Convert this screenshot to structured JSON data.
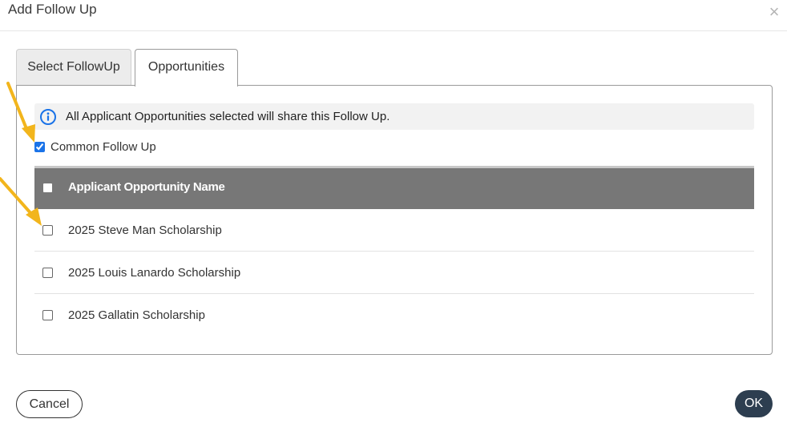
{
  "dialog": {
    "title": "Add Follow Up",
    "close_icon": "close-icon"
  },
  "tabs": [
    {
      "label": "Select FollowUp",
      "active": false
    },
    {
      "label": "Opportunities",
      "active": true
    }
  ],
  "info": {
    "icon": "info-icon",
    "text": "All Applicant Opportunities selected will share this Follow Up."
  },
  "common_follow_up": {
    "label": "Common Follow Up",
    "checked": true
  },
  "table": {
    "header": "Applicant Opportunity Name",
    "rows": [
      {
        "name": "2025 Steve Man Scholarship",
        "checked": false
      },
      {
        "name": "2025 Louis Lanardo Scholarship",
        "checked": false
      },
      {
        "name": "2025 Gallatin Scholarship",
        "checked": false
      }
    ]
  },
  "footer": {
    "cancel_label": "Cancel",
    "ok_label": "OK"
  },
  "colors": {
    "header_bg": "#777777",
    "ok_bg": "#2d3e50",
    "checkbox_accent": "#1a73e8",
    "arrow": "#f2b51c"
  }
}
